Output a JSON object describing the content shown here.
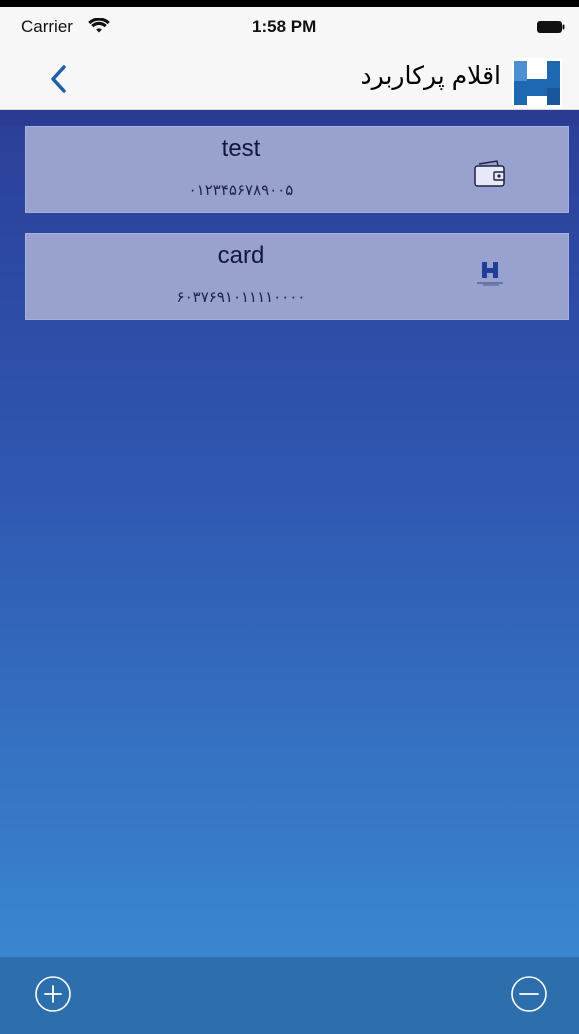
{
  "status_bar": {
    "carrier": "Carrier",
    "time": "1:58 PM",
    "wifi_icon": "wifi-icon",
    "battery_icon": "battery-icon"
  },
  "nav_bar": {
    "title": "اقلام پرکاربرد",
    "back_icon": "chevron-left-icon",
    "logo_icon": "bank-logo-icon",
    "accent_color": "#1f5ea8"
  },
  "cards": [
    {
      "name": "test",
      "number": "۰۱۲۳۴۵۶۷۸۹۰۰۵",
      "icon": "wallet-icon"
    },
    {
      "name": "card",
      "number": "۶۰۳۷۶۹۱۰۱۱۱۱۰۰۰۰",
      "icon": "bank-card-icon"
    }
  ],
  "toolbar": {
    "add_icon": "plus-circle-icon",
    "remove_icon": "minus-circle-icon"
  },
  "colors": {
    "background_top": "#2b3f98",
    "background_bottom": "#3a86cf",
    "card_bg": "#99a1ce",
    "toolbar_bg": "#2d6fad"
  }
}
